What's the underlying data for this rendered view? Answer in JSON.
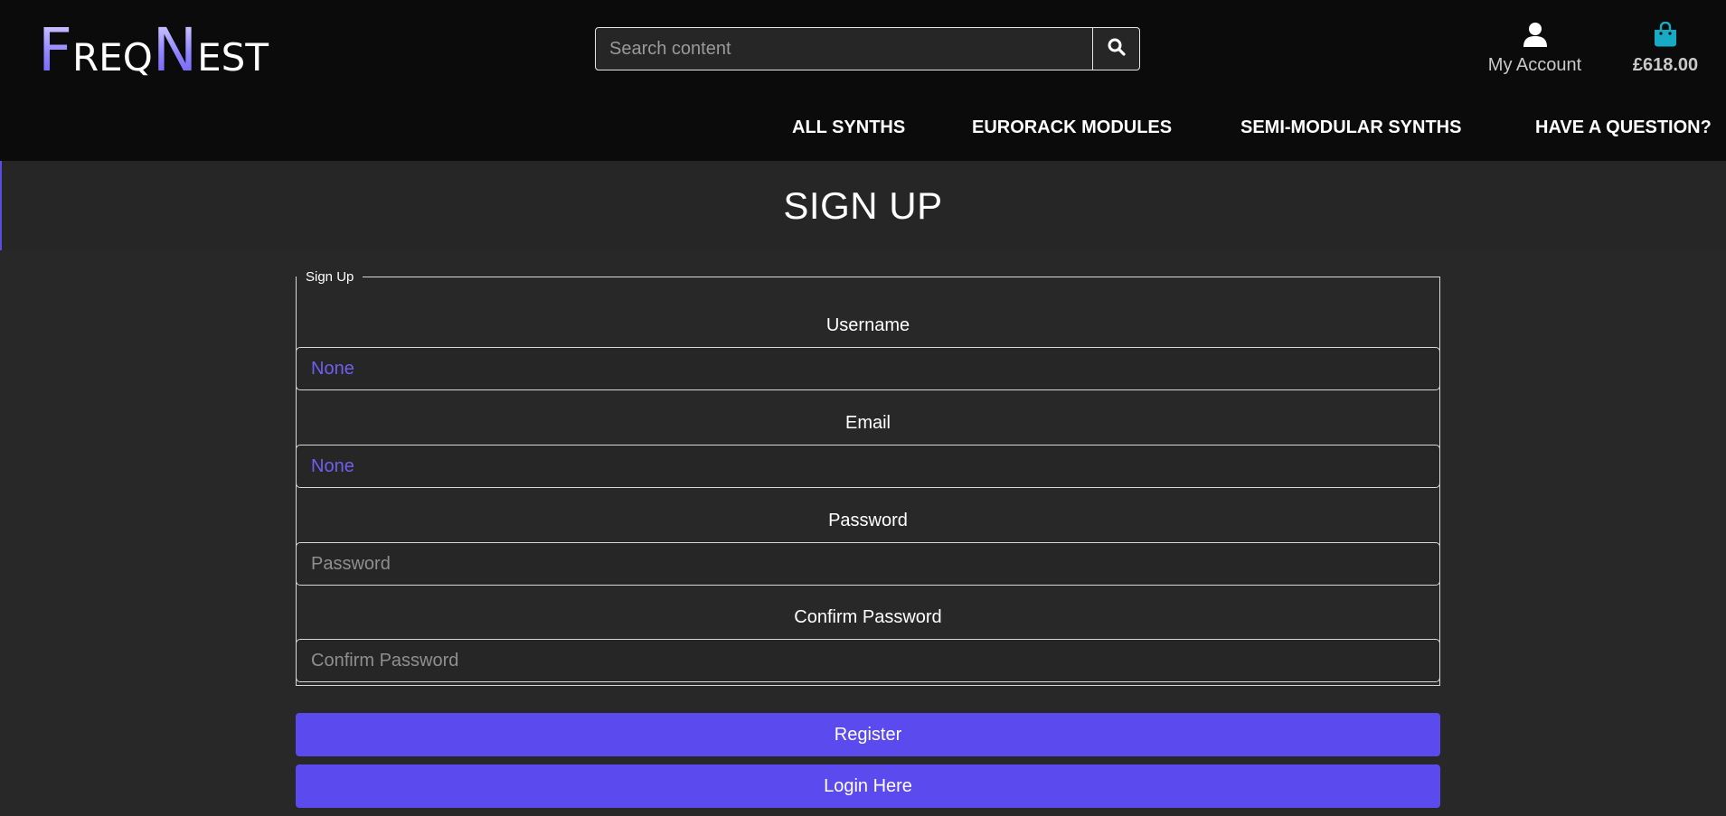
{
  "brand": {
    "logo_f": "F",
    "logo_req": "REQ",
    "logo_n": "N",
    "logo_est": "EST"
  },
  "search": {
    "placeholder": "Search content"
  },
  "header": {
    "account_label": "My Account",
    "bag_total": "£618.00"
  },
  "nav": {
    "items": [
      {
        "label": "ALL SYNTHS"
      },
      {
        "label": "EURORACK MODULES"
      },
      {
        "label": "SEMI-MODULAR SYNTHS"
      },
      {
        "label": "HAVE A QUESTION?"
      }
    ]
  },
  "page": {
    "title": "SIGN UP"
  },
  "form": {
    "legend": "Sign Up",
    "username_label": "Username",
    "username_value": "None",
    "email_label": "Email",
    "email_value": "None",
    "password_label": "Password",
    "password_placeholder": "Password",
    "confirm_label": "Confirm Password",
    "confirm_placeholder": "Confirm Password"
  },
  "buttons": {
    "register": "Register",
    "login": "Login Here"
  },
  "colors": {
    "accent": "#5b4aed",
    "bag_icon": "#18a9c4",
    "header_bg": "#0b0b0b",
    "page_bg": "#262626"
  }
}
